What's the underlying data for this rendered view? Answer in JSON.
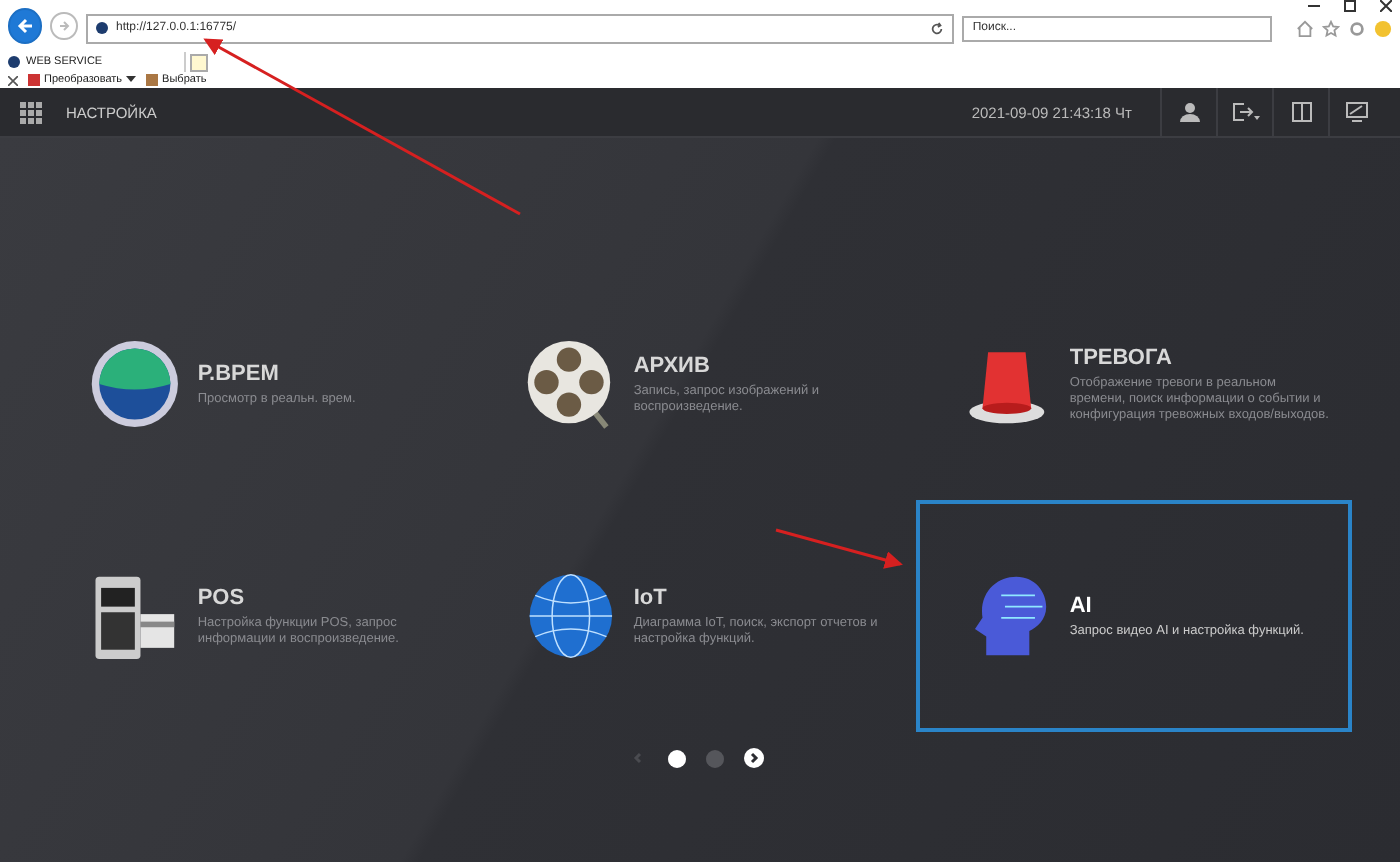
{
  "browser": {
    "url": "http://127.0.0.1:16775/",
    "search": {
      "placeholder": "Поиск..."
    },
    "tab": {
      "title": "WEB SERVICE"
    },
    "favorites": [
      {
        "label": "Преобразовать",
        "kind": "dropdown"
      },
      {
        "label": "Выбрать",
        "kind": "plain"
      }
    ]
  },
  "header": {
    "title": "НАСТРОЙКА",
    "datetime": "2021-09-09 21:43:18 Чт"
  },
  "tiles": [
    {
      "kind": "live",
      "title": "Р.ВРЕМ",
      "description": "Просмотр в реальн. врем.",
      "selected": false
    },
    {
      "kind": "archive",
      "title": "АРХИВ",
      "description": "Запись, запрос изображений и воспроизведение.",
      "selected": false
    },
    {
      "kind": "alarm",
      "title": "ТРЕВОГА",
      "description": "Отображение тревоги в реальном времени, поиск информации о событии и конфигурация тревожных входов/выходов.",
      "selected": false
    },
    {
      "kind": "pos",
      "title": "POS",
      "description": "Настройка функции POS, запрос информации и воспроизведение.",
      "selected": false
    },
    {
      "kind": "iot",
      "title": "IoT",
      "description": "Диаграмма IoT, поиск, экспорт отчетов и настройка функций.",
      "selected": false
    },
    {
      "kind": "ai",
      "title": "AI",
      "description": "Запрос видео AI и настройка функций.",
      "selected": true
    }
  ],
  "pager": {
    "previous": {
      "disabled": true
    },
    "pages": [
      {
        "selected": true
      },
      {
        "selected": false
      }
    ],
    "next": {
      "disabled": false
    }
  }
}
